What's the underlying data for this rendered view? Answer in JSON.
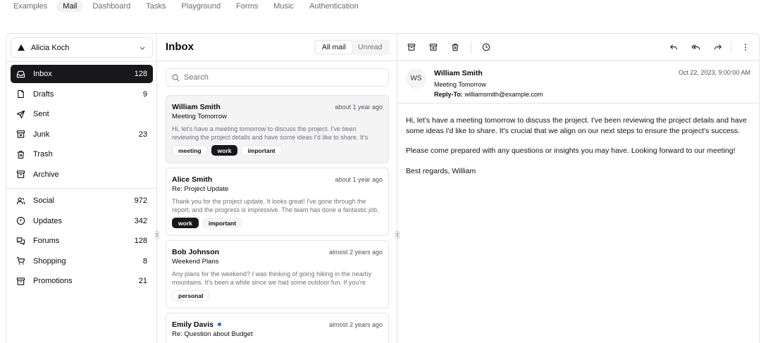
{
  "topnav": {
    "items": [
      "Examples",
      "Mail",
      "Dashboard",
      "Tasks",
      "Playground",
      "Forms",
      "Music",
      "Authentication"
    ],
    "active": "Mail"
  },
  "account": {
    "name": "Alicia Koch"
  },
  "sidebar": {
    "primary": [
      {
        "label": "Inbox",
        "count": "128",
        "icon": "inbox-icon"
      },
      {
        "label": "Drafts",
        "count": "9",
        "icon": "file-icon"
      },
      {
        "label": "Sent",
        "count": "",
        "icon": "send-icon"
      },
      {
        "label": "Junk",
        "count": "23",
        "icon": "archive-x-icon"
      },
      {
        "label": "Trash",
        "count": "",
        "icon": "trash-icon"
      },
      {
        "label": "Archive",
        "count": "",
        "icon": "archive-icon"
      }
    ],
    "secondary": [
      {
        "label": "Social",
        "count": "972",
        "icon": "users-icon"
      },
      {
        "label": "Updates",
        "count": "342",
        "icon": "alert-circle-icon"
      },
      {
        "label": "Forums",
        "count": "128",
        "icon": "messages-icon"
      },
      {
        "label": "Shopping",
        "count": "8",
        "icon": "cart-icon"
      },
      {
        "label": "Promotions",
        "count": "21",
        "icon": "archive-icon"
      }
    ]
  },
  "mail_list": {
    "title": "Inbox",
    "tabs": [
      "All mail",
      "Unread"
    ],
    "search_placeholder": "Search",
    "items": [
      {
        "from": "William Smith",
        "date": "about 1 year ago",
        "subject": "Meeting Tomorrow",
        "preview": "Hi, let's have a meeting tomorrow to discuss the project. I've been reviewing the project details and have some ideas I'd like to share. It's crucial that we align on our next steps to ensure the project's success.",
        "labels": [
          "meeting",
          "work",
          "important"
        ],
        "unread": false
      },
      {
        "from": "Alice Smith",
        "date": "about 1 year ago",
        "subject": "Re: Project Update",
        "preview": "Thank you for the project update. It looks great! I've gone through the report, and the progress is impressive. The team has done a fantastic job, and I appreciate the hard work everyone has put in.",
        "labels": [
          "work",
          "important"
        ],
        "unread": false
      },
      {
        "from": "Bob Johnson",
        "date": "almost 2 years ago",
        "subject": "Weekend Plans",
        "preview": "Any plans for the weekend? I was thinking of going hiking in the nearby mountains. It's been a while since we had some outdoor fun. If you're interested, let me know.",
        "labels": [
          "personal"
        ],
        "unread": false
      },
      {
        "from": "Emily Davis",
        "date": "almost 2 years ago",
        "subject": "Re: Question about Budget",
        "preview": "",
        "labels": [],
        "unread": true
      }
    ]
  },
  "mail_view": {
    "avatar_initials": "WS",
    "from": "William Smith",
    "subject": "Meeting Tomorrow",
    "reply_to_label": "Reply-To:",
    "reply_to": "williamsmith@example.com",
    "date": "Oct 22, 2023, 9:00:00 AM",
    "body": [
      "Hi, let's have a meeting tomorrow to discuss the project. I've been reviewing the project details and have some ideas I'd like to share. It's crucial that we align on our next steps to ensure the project's success.",
      "Please come prepared with any questions or insights you may have. Looking forward to our meeting!",
      "Best regards, William"
    ]
  }
}
